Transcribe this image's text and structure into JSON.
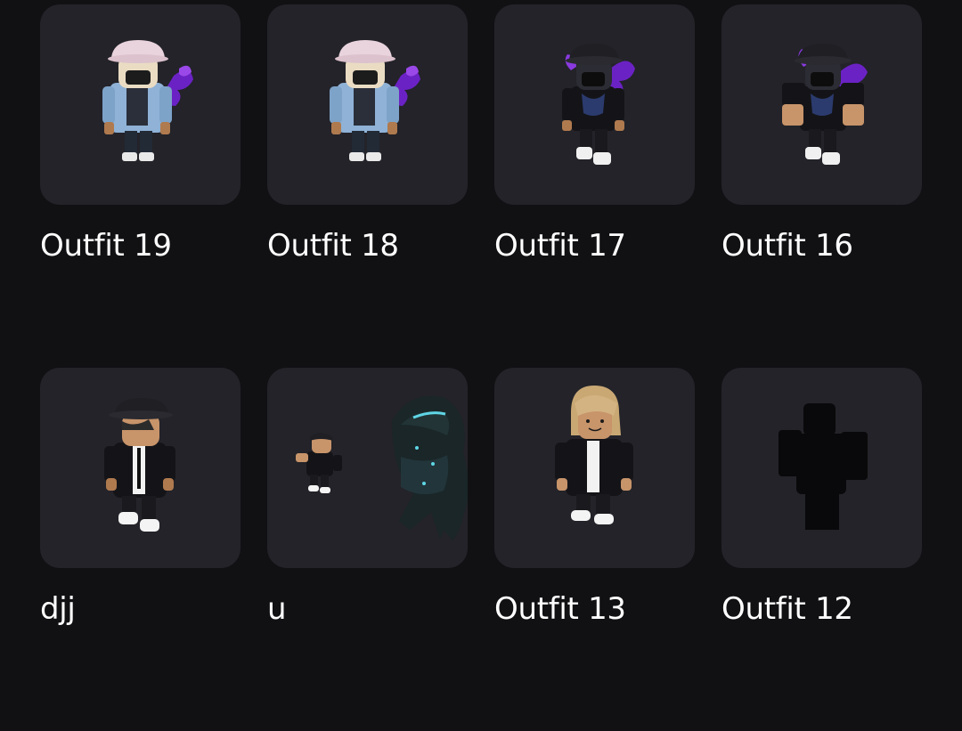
{
  "outfits": [
    {
      "name": "Outfit 19",
      "avatar": "bucket-hat-denim-jacket-avatar"
    },
    {
      "name": "Outfit 18",
      "avatar": "bucket-hat-denim-jacket-avatar"
    },
    {
      "name": "Outfit 17",
      "avatar": "black-bucket-hat-purple-aura-avatar"
    },
    {
      "name": "Outfit 16",
      "avatar": "black-bucket-hat-purple-aura-avatar"
    },
    {
      "name": "djj",
      "avatar": "black-hat-suit-avatar"
    },
    {
      "name": "u",
      "avatar": "small-avatar-with-godzilla"
    },
    {
      "name": "Outfit 13",
      "avatar": "blonde-hair-black-suit-avatar"
    },
    {
      "name": "Outfit 12",
      "avatar": "dark-silhouette-avatar"
    }
  ],
  "colors": {
    "background": "#111114",
    "card": "#232329",
    "text": "#ffffff",
    "purple_accent": "#7a2fd0",
    "denim": "#8fb2d6"
  }
}
